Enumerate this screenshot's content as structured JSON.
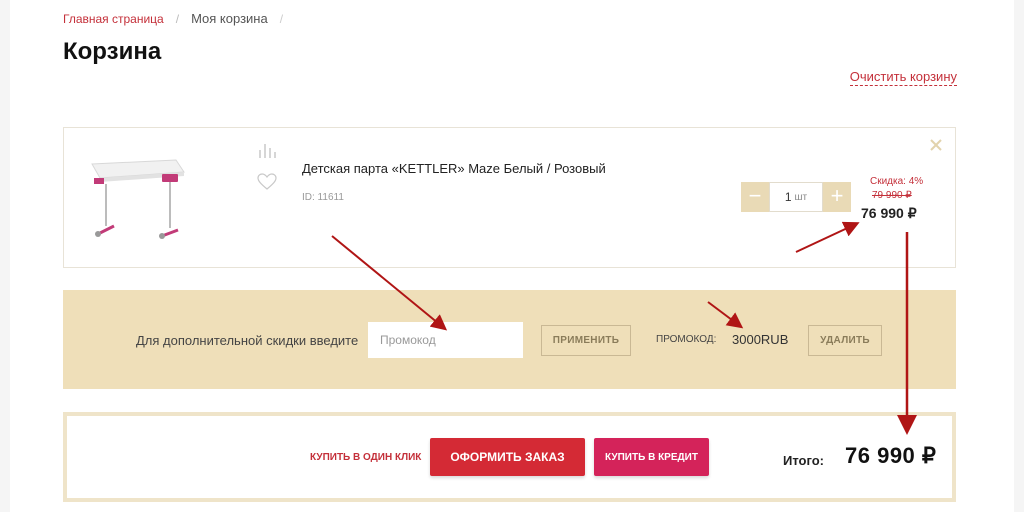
{
  "breadcrumb": {
    "home": "Главная страница",
    "current": "Моя корзина"
  },
  "page_title": "Корзина",
  "clear_cart": "Очистить корзину",
  "cart_item": {
    "name": "Детская парта «KETTLER» Maze Белый / Розовый",
    "id": "ID: 11611",
    "quantity": "1",
    "unit": "шт",
    "discount": "Скидка: 4%",
    "old_price": "79 990 ₽",
    "price": "76 990 ₽"
  },
  "promo": {
    "label": "Для дополнительной скидки введите",
    "placeholder": "Промокод",
    "apply": "ПРИМЕНИТЬ",
    "code_label": "ПРОМОКОД:",
    "code_value": "3000RUB",
    "delete": "УДАЛИТЬ"
  },
  "checkout": {
    "one_click": "КУПИТЬ В ОДИН КЛИК",
    "order": "ОФОРМИТЬ ЗАКАЗ",
    "credit": "КУПИТЬ В КРЕДИТ",
    "total_label": "Итого:",
    "total_value": "76 990 ₽"
  },
  "colors": {
    "accent": "#c4303a",
    "order_button": "#d42a35",
    "credit_button": "#d4235a",
    "promo_background": "#efdfb9",
    "annotation_arrow": "#b01515"
  },
  "icons": [
    "compare-icon",
    "heart-icon",
    "close-icon",
    "minus-icon",
    "plus-icon"
  ]
}
